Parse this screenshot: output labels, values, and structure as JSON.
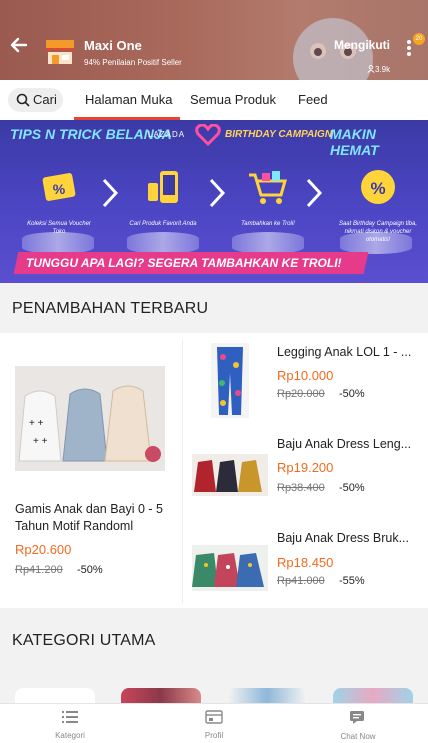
{
  "header": {
    "shop_name": "Maxi One",
    "rating": "94% Penilaian Positif Seller",
    "follow_label": "Mengikuti",
    "follow_badge": "20",
    "followers": "3.9k"
  },
  "tabs": {
    "search_label": "Cari",
    "items": [
      "Halaman Muka",
      "Semua Produk",
      "Feed"
    ],
    "active": "Halaman Muka"
  },
  "banner": {
    "left_text": "TIPS N TRICK BELANJA",
    "brand": "LAZADA",
    "campaign": "BIRTHDAY CAMPAIGN",
    "right_text": "MAKIN HEMAT",
    "steps": [
      "Koleksi Semua Voucher Toko",
      "Cari Produk Favorit Anda",
      "Tambahkan ke Troli!",
      "Saat Birthday Campaign tiba, nikmati diskon & voucher otomatis!"
    ],
    "cta": "TUNGGU APA LAGI? SEGERA TAMBAHKAN KE TROLI!"
  },
  "sections": {
    "new_items_title": "PENAMBAHAN TERBARU",
    "categories_title": "KATEGORI UTAMA"
  },
  "new_items": {
    "featured": {
      "name": "Gamis Anak dan Bayi 0 - 5 Tahun Motif Randoml",
      "price": "Rp20.600",
      "old_price": "Rp41.200",
      "discount": "-50%"
    },
    "list": [
      {
        "name": "Legging Anak LOL 1 - ...",
        "price": "Rp10.000",
        "old_price": "Rp20.000",
        "discount": "-50%"
      },
      {
        "name": "Baju Anak Dress Leng...",
        "price": "Rp19.200",
        "old_price": "Rp38.400",
        "discount": "-50%"
      },
      {
        "name": "Baju Anak Dress Bruk...",
        "price": "Rp18.450",
        "old_price": "Rp41.000",
        "discount": "-55%"
      }
    ]
  },
  "bottom_nav": {
    "items": [
      "Kategori",
      "Profil",
      "Chat Now"
    ]
  },
  "colors": {
    "accent": "#e7452e",
    "price": "#f26b1d",
    "header": "#a8685a",
    "banner": "#4c46c4"
  }
}
